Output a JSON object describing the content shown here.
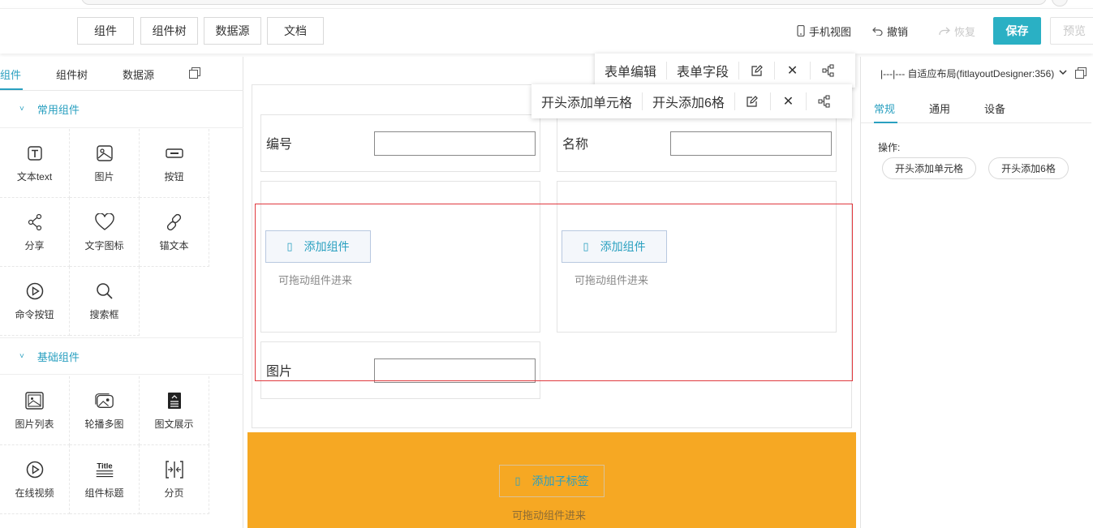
{
  "toolbar": {
    "buttons": [
      "组件",
      "组件树",
      "数据源",
      "文档"
    ],
    "mobile_view": "手机视图",
    "undo": "撤销",
    "redo": "恢复",
    "save": "保存",
    "preview": "预览"
  },
  "left_panel": {
    "tabs": [
      "组件",
      "组件树",
      "数据源"
    ],
    "sections": {
      "common": {
        "title": "常用组件",
        "items": [
          {
            "label": "文本text",
            "icon": "text-icon"
          },
          {
            "label": "图片",
            "icon": "image-icon"
          },
          {
            "label": "按钮",
            "icon": "button-icon"
          },
          {
            "label": "分享",
            "icon": "share-icon"
          },
          {
            "label": "文字图标",
            "icon": "heart-icon"
          },
          {
            "label": "锚文本",
            "icon": "link-icon"
          },
          {
            "label": "命令按钮",
            "icon": "play-circle-icon"
          },
          {
            "label": "搜索框",
            "icon": "search-icon"
          }
        ]
      },
      "basic": {
        "title": "基础组件",
        "items": [
          {
            "label": "图片列表",
            "icon": "image-list-icon"
          },
          {
            "label": "轮播多图",
            "icon": "carousel-icon"
          },
          {
            "label": "图文展示",
            "icon": "article-icon"
          },
          {
            "label": "在线视频",
            "icon": "video-icon"
          },
          {
            "label": "组件标题",
            "icon": "title-icon"
          },
          {
            "label": "分页",
            "icon": "pagination-icon"
          }
        ]
      }
    }
  },
  "canvas": {
    "popover_form": {
      "edit": "表单编辑",
      "fields": "表单字段"
    },
    "popover_layout": {
      "prepend_cell": "开头添加单元格",
      "prepend_six": "开头添加6格"
    },
    "fields": {
      "number": "编号",
      "name": "名称",
      "image": "图片"
    },
    "add_component": "添加组件",
    "drag_hint": "可拖动组件进来",
    "add_child_tab": "添加子标签"
  },
  "right_panel": {
    "component_path": "|---|--- 自适应布局(fitlayoutDesigner:356)",
    "tabs": [
      "常规",
      "通用",
      "设备"
    ],
    "actions_label": "操作:",
    "actions": [
      "开头添加单元格",
      "开头添加6格"
    ]
  },
  "colors": {
    "accent": "#2aa0c0",
    "save": "#2ab0c4",
    "orange": "#f6a823",
    "selection": "#e0393e"
  }
}
